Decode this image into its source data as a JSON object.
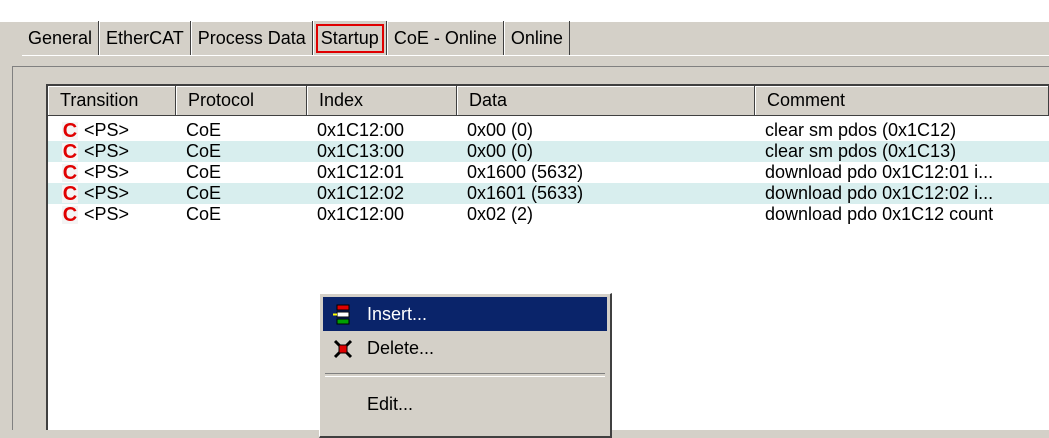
{
  "tabs": [
    {
      "label": "General"
    },
    {
      "label": "EtherCAT"
    },
    {
      "label": "Process Data"
    },
    {
      "label": "Startup"
    },
    {
      "label": "CoE - Online"
    },
    {
      "label": "Online"
    }
  ],
  "active_tab": "Startup",
  "table": {
    "columns": [
      "Transition",
      "Protocol",
      "Index",
      "Data",
      "Comment"
    ],
    "rows": [
      {
        "icon": "C",
        "transition": "<PS>",
        "protocol": "CoE",
        "index": "0x1C12:00",
        "data": "0x00 (0)",
        "comment": "clear sm pdos (0x1C12)"
      },
      {
        "icon": "C",
        "transition": "<PS>",
        "protocol": "CoE",
        "index": "0x1C13:00",
        "data": "0x00 (0)",
        "comment": "clear sm pdos (0x1C13)"
      },
      {
        "icon": "C",
        "transition": "<PS>",
        "protocol": "CoE",
        "index": "0x1C12:01",
        "data": "0x1600 (5632)",
        "comment": "download pdo 0x1C12:01 i..."
      },
      {
        "icon": "C",
        "transition": "<PS>",
        "protocol": "CoE",
        "index": "0x1C12:02",
        "data": "0x1601 (5633)",
        "comment": "download pdo 0x1C12:02 i..."
      },
      {
        "icon": "C",
        "transition": "<PS>",
        "protocol": "CoE",
        "index": "0x1C12:00",
        "data": "0x02 (2)",
        "comment": "download pdo 0x1C12 count"
      }
    ]
  },
  "context_menu": {
    "items": [
      {
        "label": "Insert...",
        "icon": "insert-icon",
        "highlighted": true
      },
      {
        "label": "Delete...",
        "icon": "delete-icon",
        "highlighted": false
      },
      {
        "label": "Edit...",
        "icon": "",
        "highlighted": false
      }
    ]
  },
  "colors": {
    "highlight": "#0a246a",
    "tab_marker": "#e00000",
    "row_alt": "#d8eeee",
    "face": "#d4d0c8"
  }
}
